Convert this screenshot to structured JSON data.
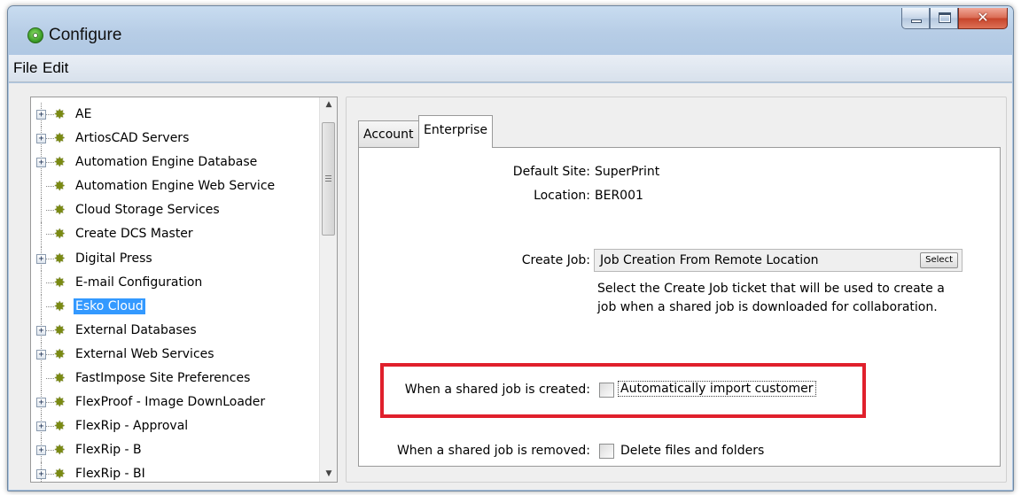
{
  "window": {
    "title": "Configure"
  },
  "menu": {
    "file": "File",
    "edit": "Edit"
  },
  "tree": {
    "items": [
      {
        "label": "AE",
        "expandable": true
      },
      {
        "label": "ArtiosCAD Servers",
        "expandable": true
      },
      {
        "label": "Automation Engine Database",
        "expandable": true
      },
      {
        "label": "Automation Engine Web Service",
        "expandable": false
      },
      {
        "label": "Cloud Storage Services",
        "expandable": false
      },
      {
        "label": "Create DCS Master",
        "expandable": false
      },
      {
        "label": "Digital Press",
        "expandable": true
      },
      {
        "label": "E-mail Configuration",
        "expandable": false
      },
      {
        "label": "Esko Cloud",
        "expandable": false,
        "selected": true
      },
      {
        "label": "External Databases",
        "expandable": true
      },
      {
        "label": "External Web Services",
        "expandable": true
      },
      {
        "label": "FastImpose Site Preferences",
        "expandable": false
      },
      {
        "label": "FlexProof - Image DownLoader",
        "expandable": true
      },
      {
        "label": "FlexRip - Approval",
        "expandable": true
      },
      {
        "label": "FlexRip - B",
        "expandable": true
      },
      {
        "label": "FlexRip - BI",
        "expandable": true
      }
    ]
  },
  "tabs": [
    {
      "label": "Account",
      "active": false
    },
    {
      "label": "Enterprise",
      "active": true
    }
  ],
  "enterprise": {
    "default_site_label": "Default Site:",
    "default_site_value": "SuperPrint",
    "location_label": "Location:",
    "location_value": "BER001",
    "create_job_label": "Create Job:",
    "create_job_value": "Job Creation From Remote Location",
    "select_button": "Select",
    "description_line1": "Select the Create Job ticket that will be used to create a",
    "description_line2": "job when a shared job is downloaded for collaboration.",
    "created_label": "When a shared job is created:",
    "created_option": "Automatically import customer",
    "created_checked": false,
    "removed_label": "When a shared job is removed:",
    "removed_option": "Delete files and folders",
    "removed_checked": false
  },
  "colors": {
    "selection": "#3399ff",
    "highlight_box": "#e0202c"
  }
}
